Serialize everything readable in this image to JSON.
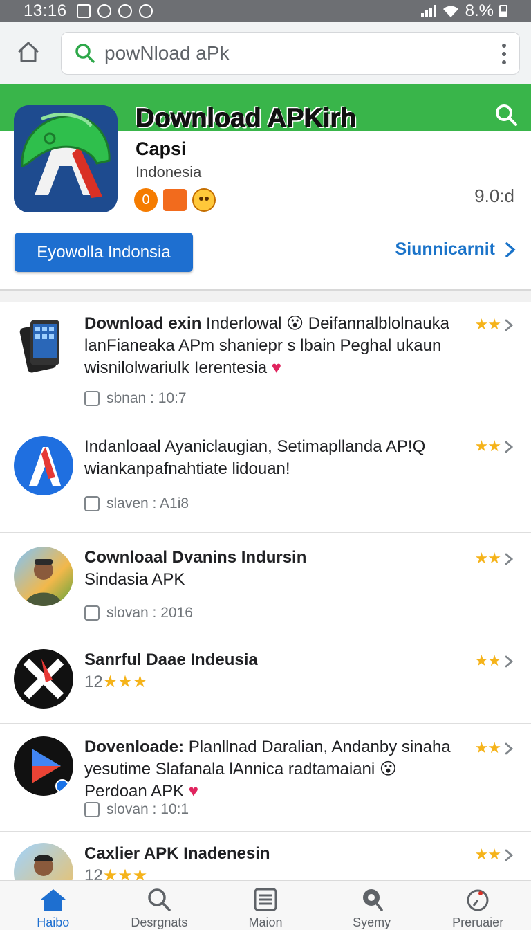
{
  "status_bar": {
    "time": "13:16",
    "battery": "8.%"
  },
  "browser": {
    "url_text": "powNload aPk"
  },
  "app": {
    "title": "Download APKirh",
    "developer": "Capsi",
    "country": "Indonesia",
    "badge_number": "0",
    "version": "9.0:d",
    "primary_button": "Eyowolla Indonsia",
    "secondary_link": "Siunnicarnit"
  },
  "list": [
    {
      "title": "Download exin",
      "text": "Inderlowal 😮 Deifannalblolnauka lanFianeaka APm shaniepr s lbain Peghal ukaun wisnilolwariulk Ierentesia",
      "meta": "sbnan : 10:7",
      "stars": "★★",
      "icon": "phone-icon"
    },
    {
      "title": "",
      "text": "Indanloaal Ayaniclaugian, Setimapllanda AP!Q wiankanpafnahtiate lidouan!",
      "meta": "slaven : A1i8",
      "stars": "★★",
      "icon": "a-logo-icon"
    },
    {
      "title": "Cownloaal Dvanins Indursin",
      "text": "Sindasia APK",
      "meta": "slovan : 2016",
      "stars": "★★",
      "icon": "avatar-icon"
    },
    {
      "title": "Sanrful Daae Indeusia",
      "text": "12",
      "inline_stars": "★★★",
      "meta": "",
      "stars": "★★",
      "icon": "x-logo-icon"
    },
    {
      "title": "Dovenloade:",
      "text": "Planllnad Daralian, Andanby sinaha yesutime Slafanala lAnnica radtamaiani 😮 Perdoan APK",
      "meta": "slovan : 10:1",
      "stars": "★★",
      "icon": "play-icon"
    },
    {
      "title": "Caxlier APK Inadenesin",
      "text": "12",
      "inline_stars": "★★★",
      "meta": "",
      "stars": "★★",
      "icon": "avatar-icon"
    }
  ],
  "nav": [
    {
      "label": "Haibo",
      "icon": "home-icon"
    },
    {
      "label": "Desrgnats",
      "icon": "search-icon"
    },
    {
      "label": "Maion",
      "icon": "list-icon"
    },
    {
      "label": "Syemy",
      "icon": "magnify-icon"
    },
    {
      "label": "Preruaier",
      "icon": "gauge-icon"
    }
  ],
  "colors": {
    "accent": "#1e6fd0",
    "green": "#39b54a",
    "star": "#f5b31a"
  }
}
